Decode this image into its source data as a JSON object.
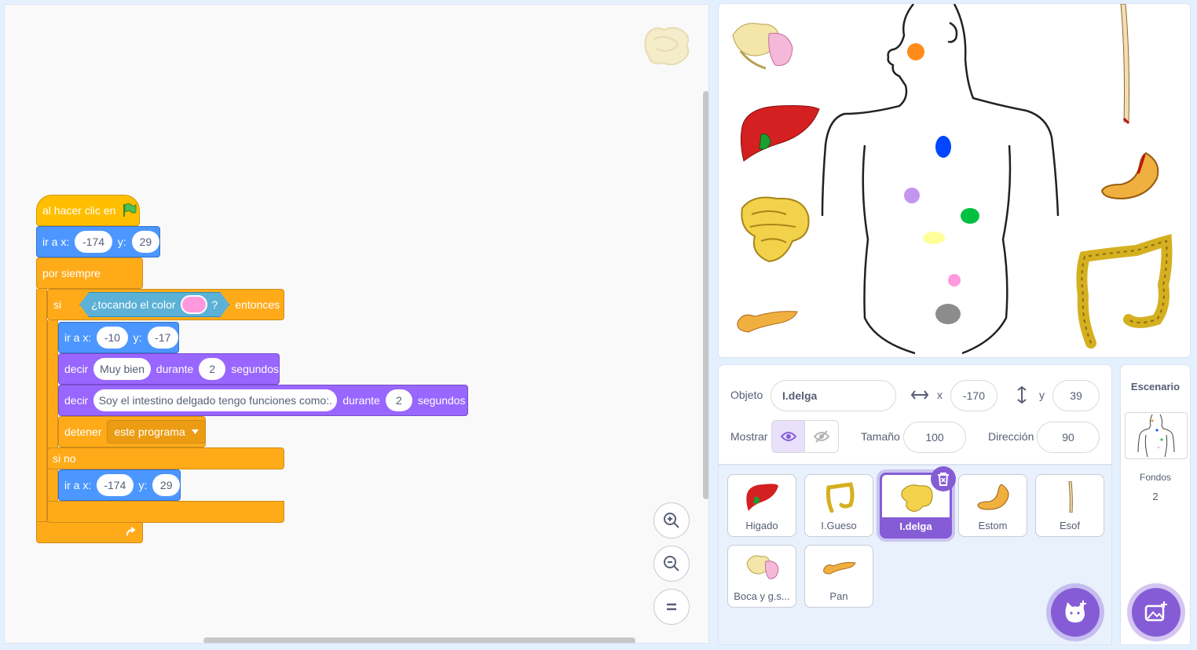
{
  "code": {
    "hat_label": "al hacer clic en",
    "goto1": {
      "label_x": "ir a x:",
      "x": "-174",
      "label_y": "y:",
      "y": "29"
    },
    "forever_label": "por siempre",
    "if_label": "si",
    "touching_label": "¿tocando el color",
    "touching_q": "?",
    "touching_color": "#ff99dd",
    "then_label": "entonces",
    "goto2": {
      "label_x": "ir a x:",
      "x": "-10",
      "label_y": "y:",
      "y": "-17"
    },
    "say1": {
      "label": "decir",
      "text": "Muy bien",
      "during": "durante",
      "secs": "2",
      "unit": "segundos"
    },
    "say2": {
      "label": "decir",
      "text": "Soy el intestino delgado tengo funciones como:.",
      "during": "durante",
      "secs": "2",
      "unit": "segundos"
    },
    "stop": {
      "label": "detener",
      "option": "este programa"
    },
    "else_label": "si no",
    "goto3": {
      "label_x": "ir a x:",
      "x": "-174",
      "label_y": "y:",
      "y": "29"
    }
  },
  "sprite_info": {
    "object_label": "Objeto",
    "name": "I.delga",
    "x_label": "x",
    "x": "-170",
    "y_label": "y",
    "y": "39",
    "show_label": "Mostrar",
    "size_label": "Tamaño",
    "size": "100",
    "direction_label": "Dirección",
    "direction": "90"
  },
  "sprites": [
    {
      "name": "Higado"
    },
    {
      "name": "I.Gueso"
    },
    {
      "name": "I.delga",
      "selected": true
    },
    {
      "name": "Estom"
    },
    {
      "name": "Esof"
    },
    {
      "name": "Boca y g.s..."
    },
    {
      "name": "Pan"
    }
  ],
  "stage_panel": {
    "title": "Escenario",
    "backdrops_label": "Fondos",
    "backdrops_count": "2"
  },
  "colors": {
    "motion": "#4c97ff",
    "looks": "#9966ff",
    "control": "#ffab19",
    "events": "#ffbf00",
    "sensing": "#5cb1d6",
    "accent": "#855cd6"
  }
}
